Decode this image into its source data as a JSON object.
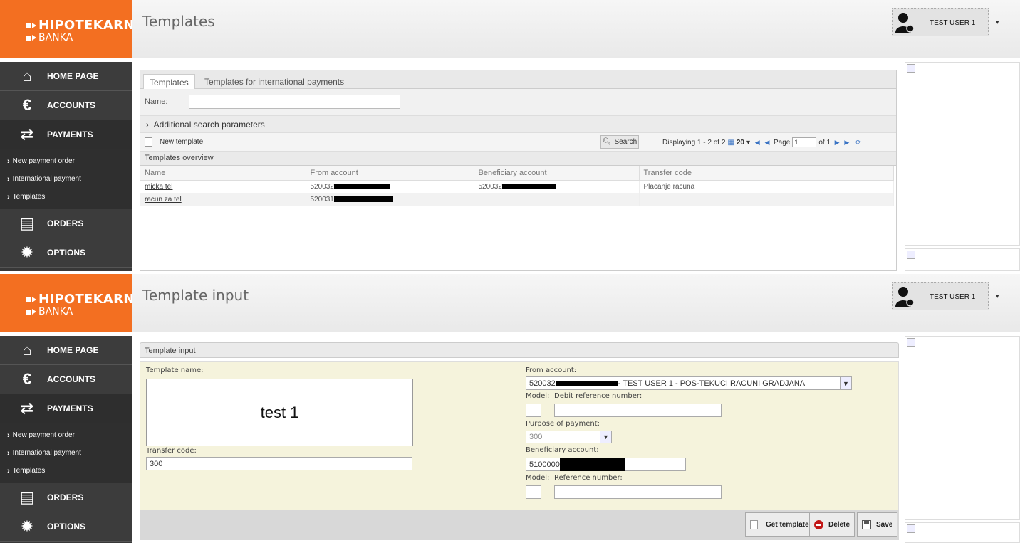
{
  "brand": {
    "line1": "HIPOTEKARNA",
    "line2": "BANKA"
  },
  "user": {
    "name": "TEST USER 1",
    "caret": "▾"
  },
  "nav": {
    "home": "HOME PAGE",
    "accounts": "ACCOUNTS",
    "payments": "PAYMENTS",
    "sub": [
      "New payment order",
      "International payment",
      "Templates"
    ],
    "orders": "ORDERS",
    "options": "OPTIONS"
  },
  "panel1": {
    "title": "Templates",
    "tabs": [
      "Templates",
      "Templates for international payments"
    ],
    "name_label": "Name:",
    "name_value": "",
    "additional": "Additional search parameters",
    "new_template": "New template",
    "search": "Search",
    "pager": {
      "displaying": "Displaying 1 - 2 of 2",
      "page_size": "20",
      "page_label": "Page",
      "page_value": "1",
      "of": "of 1"
    },
    "section": "Templates overview",
    "columns": [
      "Name",
      "From account",
      "Beneficiary account",
      "Transfer code"
    ],
    "rows": [
      {
        "name": "micka tel",
        "from": "520032",
        "beneficiary": "520032",
        "transfer": "Placanje racuna"
      },
      {
        "name": "racun za tel",
        "from": "520031",
        "beneficiary": "",
        "transfer": ""
      }
    ]
  },
  "panel2": {
    "title": "Template input",
    "section": "Template input",
    "template_name_label": "Template name:",
    "template_name_value": "test 1",
    "transfer_code_label": "Transfer code:",
    "transfer_code_value": "300",
    "from_account_label": "From account:",
    "from_account_prefix": "520032",
    "from_account_suffix": "- TEST USER 1 - POS-TEKUCI RACUNI GRADJANA",
    "model_label": "Model:",
    "debit_ref_label": "Debit reference number:",
    "purpose_label": "Purpose of payment:",
    "purpose_value": "300",
    "beneficiary_label": "Beneficiary account:",
    "beneficiary_prefix": "5100000",
    "model2_label": "Model:",
    "ref_label": "Reference number:",
    "buttons": {
      "get": "Get template",
      "delete": "Delete",
      "save": "Save"
    }
  }
}
